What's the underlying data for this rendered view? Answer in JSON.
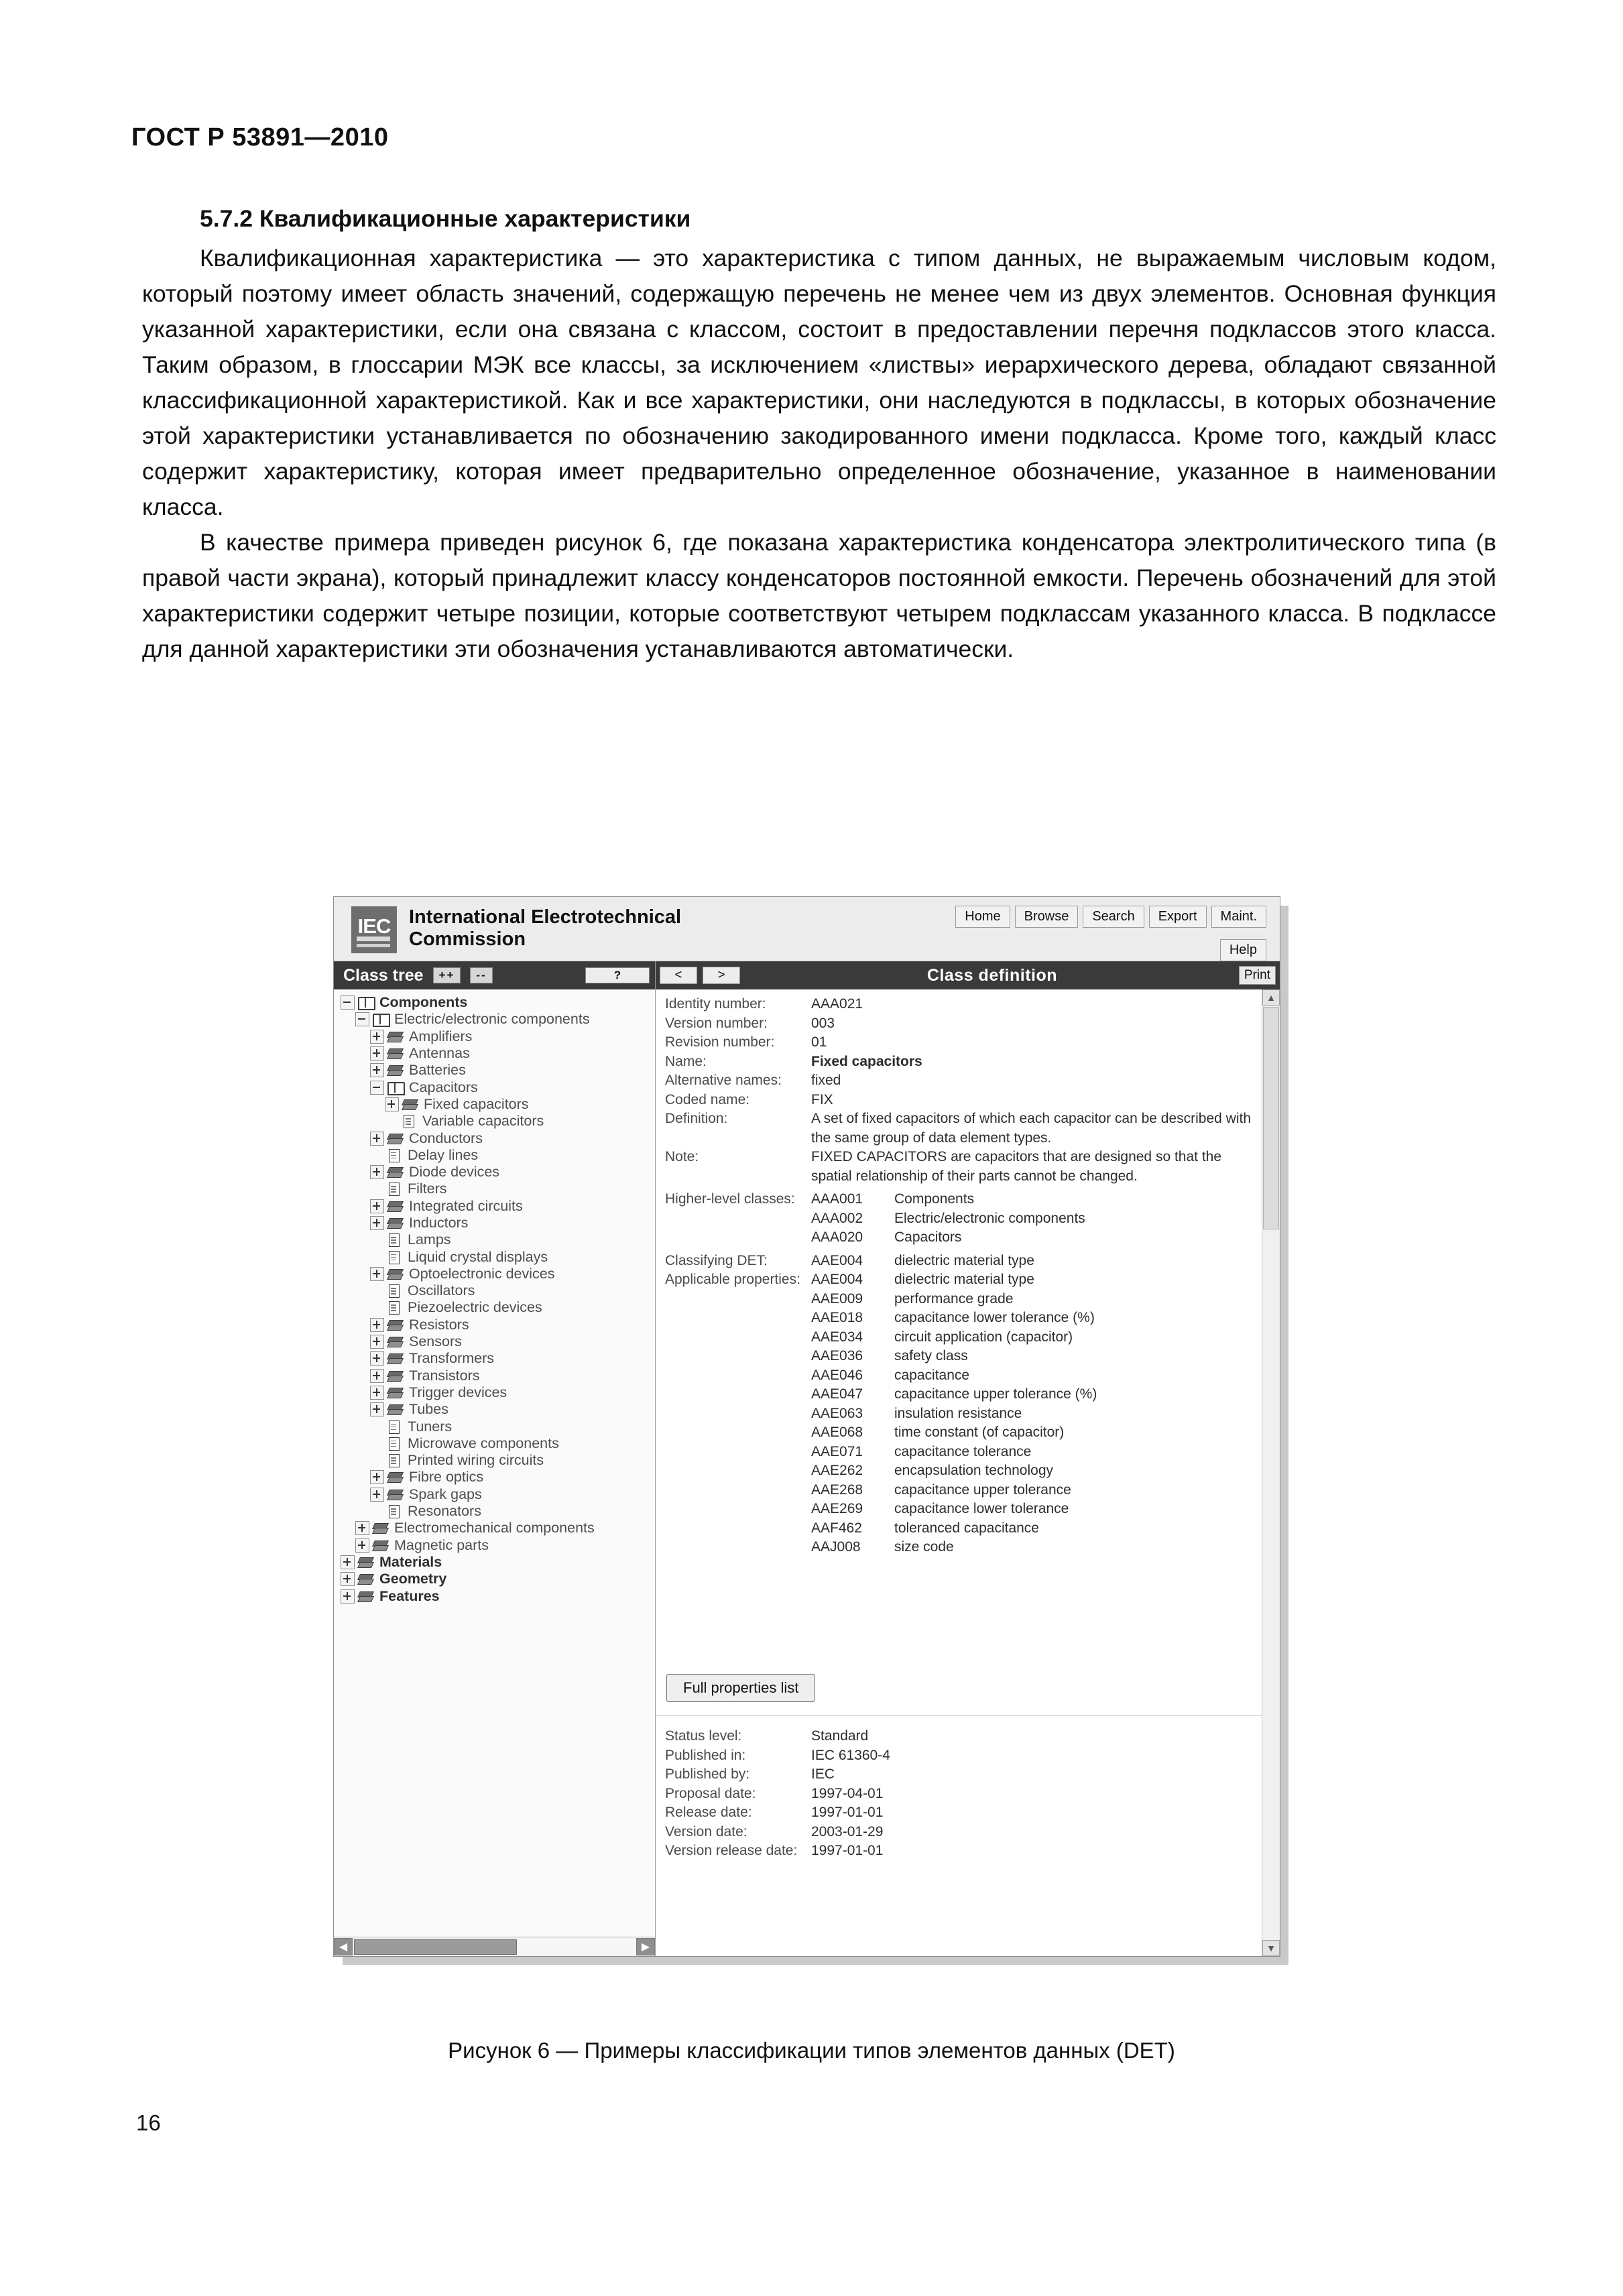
{
  "document": {
    "header": "ГОСТ Р 53891—2010",
    "page_number": "16",
    "section_title": "5.7.2 Квалификационные характеристики",
    "paragraph_1": "Квалификационная характеристика — это характеристика с типом данных, не выражаемым числовым кодом, который поэтому имеет область значений, содержащую перечень не менее чем из двух элементов. Основная функция указанной характеристики, если она связана с классом, состоит в предоставлении перечня подклассов этого класса. Таким образом, в глоссарии МЭК все классы, за исключением «листвы» иерархического дерева, обладают связанной классификационной характеристикой. Как и все характеристики, они наследуются в подклассы, в которых обозначение этой характеристики устанавливается по обозначению закодированного имени подкласса. Кроме того, каждый класс содержит характеристику, которая имеет предварительно определенное обозначение, указанное в наименовании класса.",
    "paragraph_2": "В качестве примера приведен рисунок 6, где показана характеристика конденсатора электролитического типа (в правой части экрана), который принадлежит классу конденсаторов постоянной емкости. Перечень обозначений для этой характеристики содержит четыре позиции, которые соответствуют четырем подклассам указанного класса. В подклассе для данной характеристики эти обозначения устанавливаются автоматически.",
    "figure_caption": "Рисунок 6 — Примеры классификации типов элементов данных (DET)"
  },
  "app": {
    "logo_text": "IEC",
    "org_name_line1": "International Electrotechnical",
    "org_name_line2": "Commission",
    "top_buttons": [
      "Home",
      "Browse",
      "Search",
      "Export",
      "Maint."
    ],
    "help_button": "Help",
    "tree": {
      "header_title": "Class tree",
      "expand_all_button": "++",
      "collapse_all_button": "--",
      "help_button": "?",
      "items": [
        {
          "label": "Components",
          "depth": 0,
          "toggle": "minus",
          "icon": "book-icon",
          "bold": true
        },
        {
          "label": "Electric/electronic components",
          "depth": 1,
          "toggle": "minus",
          "icon": "book-icon",
          "bold": false
        },
        {
          "label": "Amplifiers",
          "depth": 2,
          "toggle": "plus",
          "icon": "stack-icon",
          "bold": false
        },
        {
          "label": "Antennas",
          "depth": 2,
          "toggle": "plus",
          "icon": "stack-icon",
          "bold": false
        },
        {
          "label": "Batteries",
          "depth": 2,
          "toggle": "plus",
          "icon": "stack-icon",
          "bold": false
        },
        {
          "label": "Capacitors",
          "depth": 2,
          "toggle": "minus",
          "icon": "book-icon",
          "bold": false
        },
        {
          "label": "Fixed capacitors",
          "depth": 3,
          "toggle": "plus",
          "icon": "stack-icon",
          "bold": false
        },
        {
          "label": "Variable capacitors",
          "depth": 3,
          "toggle": "none",
          "icon": "document-icon",
          "bold": false
        },
        {
          "label": "Conductors",
          "depth": 2,
          "toggle": "plus",
          "icon": "stack-icon",
          "bold": false
        },
        {
          "label": "Delay lines",
          "depth": 2,
          "toggle": "none",
          "icon": "document-icon",
          "bold": false
        },
        {
          "label": "Diode devices",
          "depth": 2,
          "toggle": "plus",
          "icon": "stack-icon",
          "bold": false
        },
        {
          "label": "Filters",
          "depth": 2,
          "toggle": "none",
          "icon": "document-icon",
          "bold": false
        },
        {
          "label": "Integrated circuits",
          "depth": 2,
          "toggle": "plus",
          "icon": "stack-icon",
          "bold": false
        },
        {
          "label": "Inductors",
          "depth": 2,
          "toggle": "plus",
          "icon": "stack-icon",
          "bold": false
        },
        {
          "label": "Lamps",
          "depth": 2,
          "toggle": "none",
          "icon": "document-icon",
          "bold": false
        },
        {
          "label": "Liquid crystal displays",
          "depth": 2,
          "toggle": "none",
          "icon": "document-icon",
          "bold": false
        },
        {
          "label": "Optoelectronic devices",
          "depth": 2,
          "toggle": "plus",
          "icon": "stack-icon",
          "bold": false
        },
        {
          "label": "Oscillators",
          "depth": 2,
          "toggle": "none",
          "icon": "document-icon",
          "bold": false
        },
        {
          "label": "Piezoelectric devices",
          "depth": 2,
          "toggle": "none",
          "icon": "document-icon",
          "bold": false
        },
        {
          "label": "Resistors",
          "depth": 2,
          "toggle": "plus",
          "icon": "stack-icon",
          "bold": false
        },
        {
          "label": "Sensors",
          "depth": 2,
          "toggle": "plus",
          "icon": "stack-icon",
          "bold": false
        },
        {
          "label": "Transformers",
          "depth": 2,
          "toggle": "plus",
          "icon": "stack-icon",
          "bold": false
        },
        {
          "label": "Transistors",
          "depth": 2,
          "toggle": "plus",
          "icon": "stack-icon",
          "bold": false
        },
        {
          "label": "Trigger devices",
          "depth": 2,
          "toggle": "plus",
          "icon": "stack-icon",
          "bold": false
        },
        {
          "label": "Tubes",
          "depth": 2,
          "toggle": "plus",
          "icon": "stack-icon",
          "bold": false
        },
        {
          "label": "Tuners",
          "depth": 2,
          "toggle": "none",
          "icon": "document-icon",
          "bold": false
        },
        {
          "label": "Microwave components",
          "depth": 2,
          "toggle": "none",
          "icon": "document-icon",
          "bold": false
        },
        {
          "label": "Printed wiring circuits",
          "depth": 2,
          "toggle": "none",
          "icon": "document-icon",
          "bold": false
        },
        {
          "label": "Fibre optics",
          "depth": 2,
          "toggle": "plus",
          "icon": "stack-icon",
          "bold": false
        },
        {
          "label": "Spark gaps",
          "depth": 2,
          "toggle": "plus",
          "icon": "stack-icon",
          "bold": false
        },
        {
          "label": "Resonators",
          "depth": 2,
          "toggle": "none",
          "icon": "document-icon",
          "bold": false
        },
        {
          "label": "Electromechanical components",
          "depth": 1,
          "toggle": "plus",
          "icon": "stack-icon",
          "bold": false
        },
        {
          "label": "Magnetic parts",
          "depth": 1,
          "toggle": "plus",
          "icon": "stack-icon",
          "bold": false
        },
        {
          "label": "Materials",
          "depth": 0,
          "toggle": "plus",
          "icon": "stack-icon",
          "bold": true
        },
        {
          "label": "Geometry",
          "depth": 0,
          "toggle": "plus",
          "icon": "stack-icon",
          "bold": true
        },
        {
          "label": "Features",
          "depth": 0,
          "toggle": "plus",
          "icon": "stack-icon",
          "bold": true
        }
      ]
    },
    "detail": {
      "header_title": "Class definition",
      "prev_button": "<",
      "next_button": ">",
      "print_button": "Print",
      "fields": [
        {
          "label": "Identity number:",
          "value": "AAA021",
          "bold": false
        },
        {
          "label": "Version number:",
          "value": "003",
          "bold": false
        },
        {
          "label": "Revision number:",
          "value": "01",
          "bold": false
        },
        {
          "label": "Name:",
          "value": "Fixed capacitors",
          "bold": true
        },
        {
          "label": "Alternative names:",
          "value": "fixed",
          "bold": false
        },
        {
          "label": "Coded name:",
          "value": "FIX",
          "bold": false
        },
        {
          "label": "Definition:",
          "value": "A set of fixed capacitors of which each capacitor can be described with the same group of data element types.",
          "bold": false
        },
        {
          "label": "Note:",
          "value": "FIXED CAPACITORS are capacitors that are designed so that the spatial relationship of their parts cannot be changed.",
          "bold": false
        }
      ],
      "higher_level_classes_label": "Higher-level classes:",
      "higher_level_classes": [
        {
          "code": "AAA001",
          "name": "Components"
        },
        {
          "code": "AAA002",
          "name": "Electric/electronic components"
        },
        {
          "code": "AAA020",
          "name": "Capacitors"
        }
      ],
      "classifying_det_label": "Classifying DET:",
      "classifying_det": [
        {
          "code": "AAE004",
          "name": "dielectric material type"
        }
      ],
      "applicable_properties_label": "Applicable properties:",
      "applicable_properties": [
        {
          "code": "AAE004",
          "name": "dielectric material type"
        },
        {
          "code": "AAE009",
          "name": "performance grade"
        },
        {
          "code": "AAE018",
          "name": "capacitance lower tolerance (%)"
        },
        {
          "code": "AAE034",
          "name": "circuit application (capacitor)"
        },
        {
          "code": "AAE036",
          "name": "safety class"
        },
        {
          "code": "AAE046",
          "name": "capacitance"
        },
        {
          "code": "AAE047",
          "name": "capacitance upper tolerance (%)"
        },
        {
          "code": "AAE063",
          "name": "insulation resistance"
        },
        {
          "code": "AAE068",
          "name": "time constant (of capacitor)"
        },
        {
          "code": "AAE071",
          "name": "capacitance tolerance"
        },
        {
          "code": "AAE262",
          "name": "encapsulation technology"
        },
        {
          "code": "AAE268",
          "name": "capacitance upper tolerance"
        },
        {
          "code": "AAE269",
          "name": "capacitance lower tolerance"
        },
        {
          "code": "AAF462",
          "name": "toleranced capacitance"
        },
        {
          "code": "AAJ008",
          "name": "size code"
        }
      ],
      "full_properties_button": "Full properties list",
      "status_fields": [
        {
          "label": "Status level:",
          "value": "Standard"
        },
        {
          "label": "Published in:",
          "value": "IEC 61360-4"
        },
        {
          "label": "Published by:",
          "value": "IEC"
        },
        {
          "label": "Proposal date:",
          "value": "1997-04-01"
        },
        {
          "label": "Release date:",
          "value": "1997-01-01"
        },
        {
          "label": "Version date:",
          "value": "2003-01-29"
        },
        {
          "label": "Version release date:",
          "value": "1997-01-01"
        }
      ]
    }
  }
}
